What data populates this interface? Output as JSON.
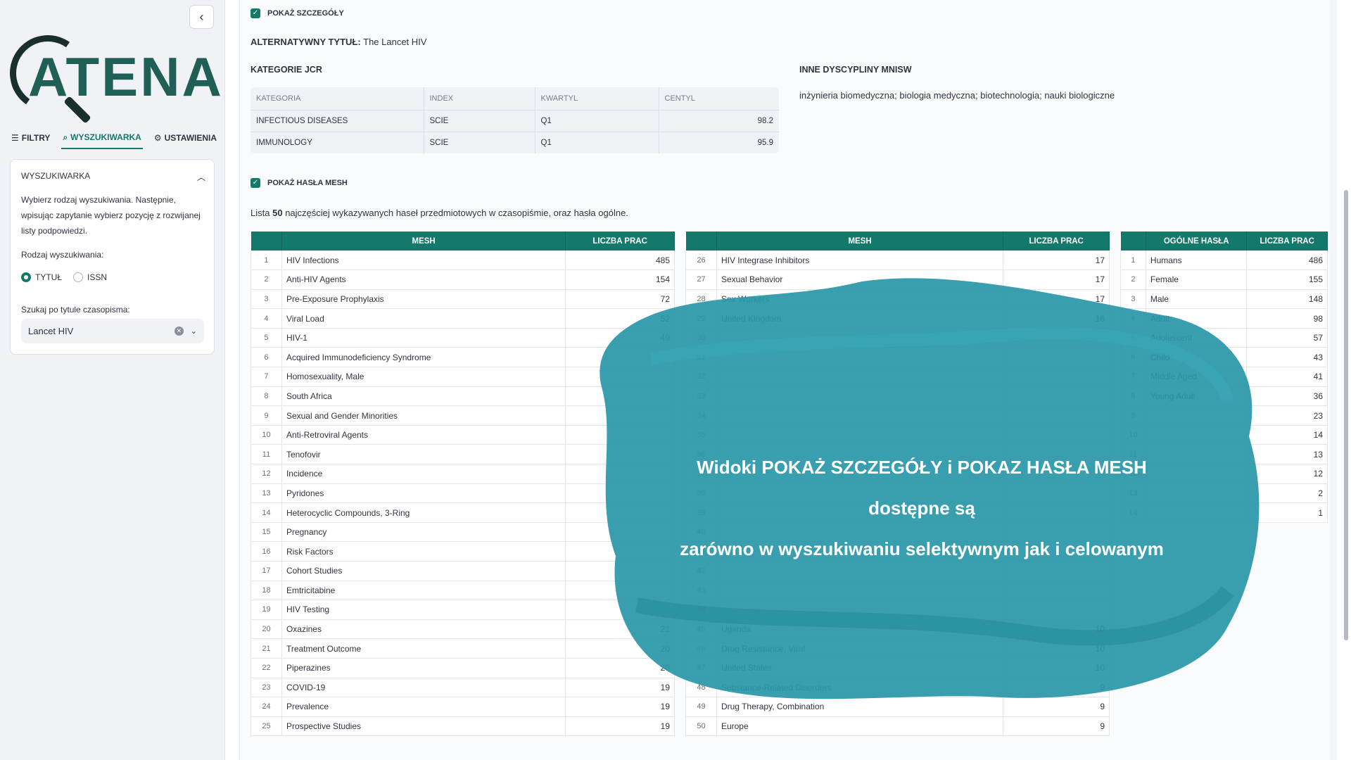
{
  "sidebar": {
    "logo_text": "ATENA",
    "tabs": [
      {
        "label": "FILTRY",
        "icon": "filter-icon"
      },
      {
        "label": "WYSZUKIWARKA",
        "icon": "search-icon"
      },
      {
        "label": "USTAWIENIA",
        "icon": "gear-icon"
      }
    ],
    "card": {
      "title": "WYSZUKIWARKA",
      "description": "Wybierz rodzaj wyszukiwania. Następnie, wpisując zapytanie wybierz pozycję z rozwijanej listy podpowiedzi.",
      "radio_label": "Rodzaj wyszukiwania:",
      "radio_options": [
        "TYTUŁ",
        "ISSN"
      ],
      "radio_selected": "TYTUŁ",
      "search_label": "Szukaj po tytule czasopisma:",
      "search_value": "Lancet HIV"
    }
  },
  "main": {
    "show_details_label": "POKAŻ SZCZEGÓŁY",
    "alt_title_label": "ALTERNATYWNY TYTUŁ",
    "alt_title_value": "The Lancet HIV",
    "jcr_heading": "KATEGORIE JCR",
    "inne_heading": "INNE DYSCYPLINY MNISW",
    "inne_value": "inżynieria biomedyczna; biologia medyczna; biotechnologia; nauki biologiczne",
    "jcr_headers": [
      "KATEGORIA",
      "INDEX",
      "KWARTYL",
      "CENTYL"
    ],
    "jcr_rows": [
      [
        "INFECTIOUS DISEASES",
        "SCIE",
        "Q1",
        "98.2"
      ],
      [
        "IMMUNOLOGY",
        "SCIE",
        "Q1",
        "95.9"
      ]
    ],
    "show_mesh_label": "POKAŻ HASŁA MESH",
    "list_intro_pre": "Lista",
    "list_intro_count": "50",
    "list_intro_post": "najczęściej wykazywanych haseł przedmiotowych w czasopiśmie, oraz hasła ogólne.",
    "mesh_headers": [
      "MESH",
      "LICZBA PRAC"
    ],
    "general_headers": [
      "OGÓLNE HASŁA",
      "LICZBA PRAC"
    ],
    "mesh_left": [
      [
        "1",
        "HIV Infections",
        "485"
      ],
      [
        "2",
        "Anti-HIV Agents",
        "154"
      ],
      [
        "3",
        "Pre-Exposure Prophylaxis",
        "72"
      ],
      [
        "4",
        "Viral Load",
        "52"
      ],
      [
        "5",
        "HIV-1",
        "49"
      ],
      [
        "6",
        "Acquired Immunodeficiency Syndrome",
        ""
      ],
      [
        "7",
        "Homosexuality, Male",
        ""
      ],
      [
        "8",
        "South Africa",
        ""
      ],
      [
        "9",
        "Sexual and Gender Minorities",
        ""
      ],
      [
        "10",
        "Anti-Retroviral Agents",
        ""
      ],
      [
        "11",
        "Tenofovir",
        ""
      ],
      [
        "12",
        "Incidence",
        ""
      ],
      [
        "13",
        "Pyridones",
        ""
      ],
      [
        "14",
        "Heterocyclic Compounds, 3-Ring",
        ""
      ],
      [
        "15",
        "Pregnancy",
        ""
      ],
      [
        "16",
        "Risk Factors",
        ""
      ],
      [
        "17",
        "Cohort Studies",
        ""
      ],
      [
        "18",
        "Emtricitabine",
        ""
      ],
      [
        "19",
        "HIV Testing",
        ""
      ],
      [
        "20",
        "Oxazines",
        "21"
      ],
      [
        "21",
        "Treatment Outcome",
        "20"
      ],
      [
        "22",
        "Piperazines",
        "20"
      ],
      [
        "23",
        "COVID-19",
        "19"
      ],
      [
        "24",
        "Prevalence",
        "19"
      ],
      [
        "25",
        "Prospective Studies",
        "19"
      ]
    ],
    "mesh_right": [
      [
        "26",
        "HIV Integrase Inhibitors",
        "17"
      ],
      [
        "27",
        "Sexual Behavior",
        "17"
      ],
      [
        "28",
        "Sex Workers",
        "17"
      ],
      [
        "29",
        "United Kingdom",
        "16"
      ],
      [
        "30",
        "",
        ""
      ],
      [
        "31",
        "",
        ""
      ],
      [
        "32",
        "",
        ""
      ],
      [
        "33",
        "",
        ""
      ],
      [
        "34",
        "",
        ""
      ],
      [
        "35",
        "",
        ""
      ],
      [
        "36",
        "",
        ""
      ],
      [
        "37",
        "",
        ""
      ],
      [
        "38",
        "",
        ""
      ],
      [
        "39",
        "",
        ""
      ],
      [
        "40",
        "",
        ""
      ],
      [
        "41",
        "",
        ""
      ],
      [
        "42",
        "",
        ""
      ],
      [
        "43",
        "",
        ""
      ],
      [
        "44",
        "",
        ""
      ],
      [
        "45",
        "Uganda",
        "10"
      ],
      [
        "46",
        "Drug Resistance, Viral",
        "10"
      ],
      [
        "47",
        "United States",
        "10"
      ],
      [
        "48",
        "Substance-Related Disorders",
        "9"
      ],
      [
        "49",
        "Drug Therapy, Combination",
        "9"
      ],
      [
        "50",
        "Europe",
        "9"
      ]
    ],
    "general": [
      [
        "1",
        "Humans",
        "486"
      ],
      [
        "2",
        "Female",
        "155"
      ],
      [
        "3",
        "Male",
        "148"
      ],
      [
        "4",
        "Adult",
        "98"
      ],
      [
        "5",
        "Adolescent",
        "57"
      ],
      [
        "6",
        "Child",
        "43"
      ],
      [
        "7",
        "Middle Aged",
        "41"
      ],
      [
        "8",
        "Young Adult",
        "36"
      ],
      [
        "9",
        "",
        "23"
      ],
      [
        "10",
        "",
        "14"
      ],
      [
        "11",
        "",
        "13"
      ],
      [
        "12",
        "",
        "12"
      ],
      [
        "13",
        "",
        "2"
      ],
      [
        "14",
        "",
        "1"
      ]
    ],
    "overlay_line1": "Widoki POKAŻ SZCZEGÓŁY i POKAZ HASŁA MESH dostępne są",
    "overlay_line2": "zarówno w wyszukiwaniu selektywnym jak i celowanym",
    "overlay_color": "#2a97a8",
    "accent_color": "#12796b"
  }
}
